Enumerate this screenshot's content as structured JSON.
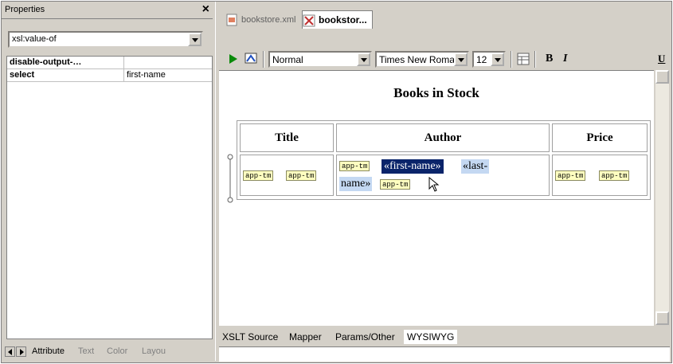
{
  "properties_panel": {
    "title": "Properties",
    "close_glyph": "×",
    "element_select": "xsl:value-of",
    "rows": [
      {
        "key": "disable-output-…",
        "value": ""
      },
      {
        "key": "select",
        "value": "first-name"
      }
    ],
    "tabs": [
      "Attribute",
      "Text",
      "Color",
      "Layou"
    ]
  },
  "document_tabs": [
    "bookstore.xml",
    "bookstor..."
  ],
  "toolbar": {
    "style_select": "Normal",
    "font_select": "Times New Roman",
    "size_select": "12",
    "bold_label": "B",
    "italic_label": "I",
    "underline_label": "U"
  },
  "document": {
    "heading": "Books in Stock",
    "columns": [
      "Title",
      "Author",
      "Price"
    ],
    "tag_label": "app-tm",
    "author_fields": [
      "«first-name»",
      "«last-",
      "name»"
    ]
  },
  "view_tabs": [
    "XSLT Source",
    "Mapper",
    "Params/Other",
    "WYSIWYG"
  ],
  "colors": {
    "selection": "#0a246a",
    "field_highlight": "#c4d8f2",
    "tag_fill": "#ffffc0",
    "chrome": "#d4d0c8"
  }
}
